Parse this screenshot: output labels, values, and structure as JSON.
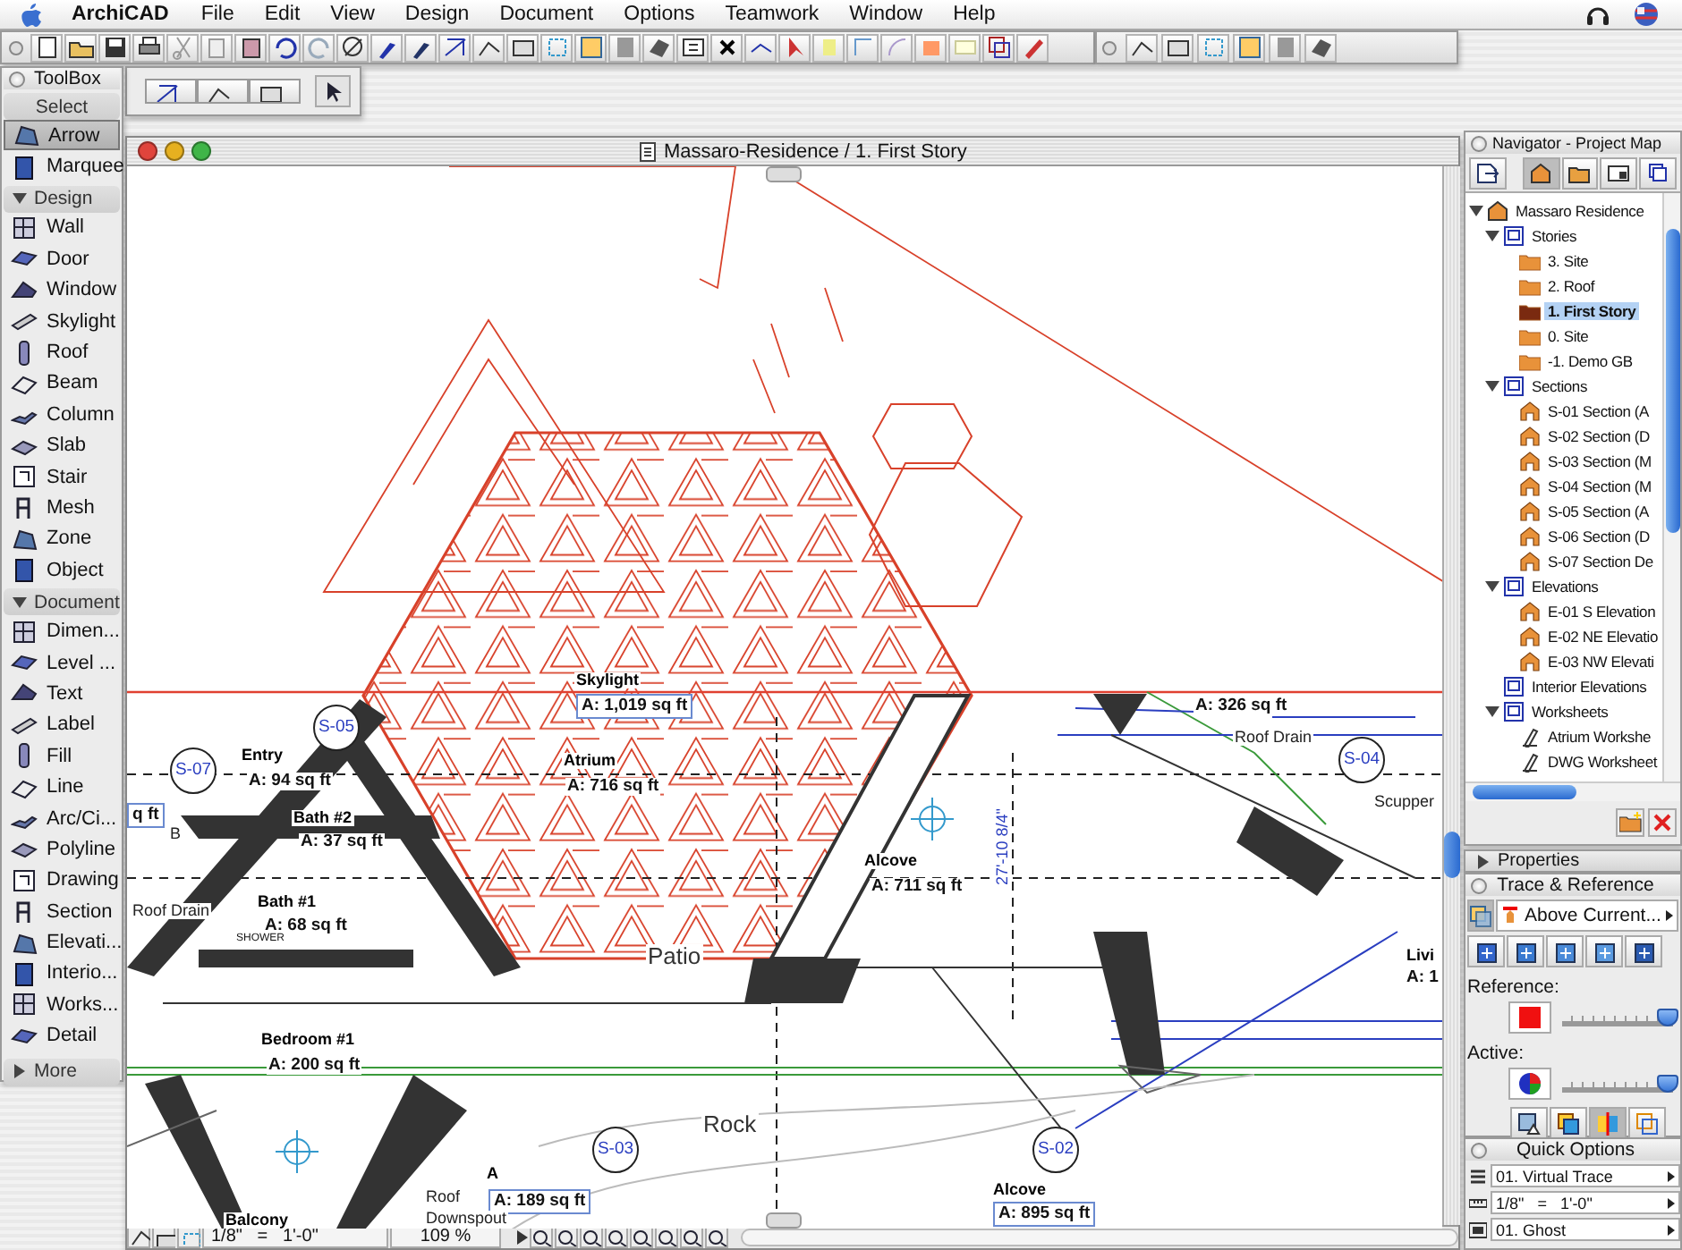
{
  "menubar": {
    "app": "ArchiCAD",
    "menus": [
      "File",
      "Edit",
      "View",
      "Design",
      "Document",
      "Options",
      "Teamwork",
      "Window",
      "Help"
    ]
  },
  "toolbox": {
    "title": "ToolBox",
    "sections": [
      {
        "header": "Select",
        "expanded": true,
        "items": [
          {
            "label": "Arrow",
            "selected": true
          },
          {
            "label": "Marquee",
            "selected": false
          }
        ]
      },
      {
        "header": "Design",
        "expanded": true,
        "items": [
          {
            "label": "Wall",
            "selected": false
          },
          {
            "label": "Door",
            "selected": false
          },
          {
            "label": "Window",
            "selected": false
          },
          {
            "label": "Skylight",
            "selected": false
          },
          {
            "label": "Roof",
            "selected": false
          },
          {
            "label": "Beam",
            "selected": false
          },
          {
            "label": "Column",
            "selected": false
          },
          {
            "label": "Slab",
            "selected": false
          },
          {
            "label": "Stair",
            "selected": false
          },
          {
            "label": "Mesh",
            "selected": false
          },
          {
            "label": "Zone",
            "selected": false
          },
          {
            "label": "Object",
            "selected": false
          }
        ]
      },
      {
        "header": "Document",
        "expanded": true,
        "items": [
          {
            "label": "Dimen...",
            "selected": false
          },
          {
            "label": "Level ...",
            "selected": false
          },
          {
            "label": "Text",
            "selected": false
          },
          {
            "label": "Label",
            "selected": false
          },
          {
            "label": "Fill",
            "selected": false
          },
          {
            "label": "Line",
            "selected": false
          },
          {
            "label": "Arc/Ci...",
            "selected": false
          },
          {
            "label": "Polyline",
            "selected": false
          },
          {
            "label": "Drawing",
            "selected": false
          },
          {
            "label": "Section",
            "selected": false
          },
          {
            "label": "Elevati...",
            "selected": false
          },
          {
            "label": "Interio...",
            "selected": false
          },
          {
            "label": "Works...",
            "selected": false
          },
          {
            "label": "Detail",
            "selected": false
          }
        ]
      },
      {
        "header": "More",
        "expanded": false
      }
    ]
  },
  "window": {
    "title": "Massaro-Residence / 1. First Story"
  },
  "plan": {
    "labels": [
      {
        "text": "Skylight",
        "kind": "name"
      },
      {
        "text": "A: 1,019 sq ft",
        "kind": "area-boxed"
      },
      {
        "text": "Atrium",
        "kind": "name"
      },
      {
        "text": "A: 716 sq ft",
        "kind": "area"
      },
      {
        "text": "Entry",
        "kind": "name"
      },
      {
        "text": "A: 94 sq ft",
        "kind": "area"
      },
      {
        "text": "q ft",
        "kind": "area-boxed"
      },
      {
        "text": "B",
        "kind": "note"
      },
      {
        "text": "Bath #2",
        "kind": "name"
      },
      {
        "text": "A: 37 sq ft",
        "kind": "area"
      },
      {
        "text": "Bath #1",
        "kind": "name"
      },
      {
        "text": "A: 68 sq ft",
        "kind": "area"
      },
      {
        "text": "Roof Drain",
        "kind": "note"
      },
      {
        "text": "SHOWER",
        "kind": "small"
      },
      {
        "text": "Bedroom #1",
        "kind": "name"
      },
      {
        "text": "A: 200 sq ft",
        "kind": "area"
      },
      {
        "text": "Alcove",
        "kind": "name"
      },
      {
        "text": "A: 711 sq ft",
        "kind": "area"
      },
      {
        "text": "A: 326 sq ft",
        "kind": "area"
      },
      {
        "text": "Roof Drain",
        "kind": "note"
      },
      {
        "text": "Scupper",
        "kind": "note"
      },
      {
        "text": "Livi",
        "kind": "name"
      },
      {
        "text": "A: 1",
        "kind": "area"
      },
      {
        "text": "Patio",
        "kind": "big"
      },
      {
        "text": "Rock",
        "kind": "big"
      },
      {
        "text": "27'-10 8/4\"",
        "kind": "dimension"
      },
      {
        "text": "S-07",
        "kind": "marker"
      },
      {
        "text": "S-05",
        "kind": "marker"
      },
      {
        "text": "S-04",
        "kind": "marker"
      },
      {
        "text": "S-03",
        "kind": "marker"
      },
      {
        "text": "S-02",
        "kind": "marker"
      },
      {
        "text": "A",
        "kind": "name"
      },
      {
        "text": "Roof",
        "kind": "note"
      },
      {
        "text": "A: 189 sq ft",
        "kind": "area-boxed"
      },
      {
        "text": "Downspout",
        "kind": "note"
      },
      {
        "text": "Alcove",
        "kind": "name"
      },
      {
        "text": "A: 895 sq ft",
        "kind": "area-boxed"
      },
      {
        "text": "Balcony",
        "kind": "name"
      }
    ]
  },
  "status_bar": {
    "scale": "1/8\"   =   1'-0\"",
    "zoom": "109 %"
  },
  "navigator": {
    "title": "Navigator - Project Map",
    "tree": [
      {
        "label": "Massaro Residence",
        "kind": "project",
        "expanded": true,
        "selected": false,
        "children": [
          {
            "label": "Stories",
            "kind": "group",
            "expanded": true,
            "selected": false,
            "children": [
              {
                "label": "3. Site",
                "kind": "story",
                "selected": false
              },
              {
                "label": "2. Roof",
                "kind": "story",
                "selected": false
              },
              {
                "label": "1. First Story",
                "kind": "story",
                "selected": true
              },
              {
                "label": "0. Site",
                "kind": "story",
                "selected": false
              },
              {
                "label": "-1. Demo GB",
                "kind": "story",
                "selected": false
              }
            ]
          },
          {
            "label": "Sections",
            "kind": "group",
            "expanded": true,
            "selected": false,
            "children": [
              {
                "label": "S-01 Section (A",
                "kind": "section",
                "selected": false
              },
              {
                "label": "S-02 Section (D",
                "kind": "section",
                "selected": false
              },
              {
                "label": "S-03 Section (M",
                "kind": "section",
                "selected": false
              },
              {
                "label": "S-04 Section (M",
                "kind": "section",
                "selected": false
              },
              {
                "label": "S-05 Section (A",
                "kind": "section",
                "selected": false
              },
              {
                "label": "S-06 Section (D",
                "kind": "section",
                "selected": false
              },
              {
                "label": "S-07 Section De",
                "kind": "section",
                "selected": false
              }
            ]
          },
          {
            "label": "Elevations",
            "kind": "group",
            "expanded": true,
            "selected": false,
            "children": [
              {
                "label": "E-01 S Elevation",
                "kind": "elevation",
                "selected": false
              },
              {
                "label": "E-02 NE Elevatio",
                "kind": "elevation",
                "selected": false
              },
              {
                "label": "E-03 NW Elevati",
                "kind": "elevation",
                "selected": false
              }
            ]
          },
          {
            "label": "Interior Elevations",
            "kind": "group",
            "selected": false
          },
          {
            "label": "Worksheets",
            "kind": "group",
            "expanded": true,
            "selected": false,
            "children": [
              {
                "label": "Atrium Workshe",
                "kind": "worksheet",
                "selected": false
              },
              {
                "label": "DWG Worksheet",
                "kind": "worksheet",
                "selected": false
              }
            ]
          }
        ]
      }
    ]
  },
  "properties": {
    "title": "Properties",
    "expanded": false
  },
  "trace": {
    "title": "Trace & Reference",
    "reference_menu": "Above Current...",
    "reference": {
      "label": "Reference:",
      "level": 0.95
    },
    "active": {
      "label": "Active:",
      "level": 0.95
    }
  },
  "quick_options": {
    "title": "Quick Options",
    "fields": [
      "01. Virtual Trace",
      "1/8\"   =   1'-0\"",
      "01. Ghost"
    ]
  }
}
